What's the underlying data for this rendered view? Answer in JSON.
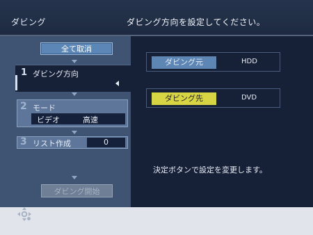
{
  "header": {
    "app_title": "ダビング",
    "instruction": "ダビング方向を設定してください。"
  },
  "left_panel": {
    "cancel_all_label": "全て取消",
    "steps": [
      {
        "number": "1",
        "label": "ダビング方向"
      },
      {
        "number": "2",
        "label": "モード",
        "values": [
          "ビデオ",
          "高速"
        ]
      },
      {
        "number": "3",
        "label": "リスト作成",
        "value": "0"
      }
    ],
    "start_button_label": "ダビング開始"
  },
  "right_panel": {
    "source": {
      "label": "ダビング元",
      "value": "HDD"
    },
    "destination": {
      "label": "ダビング先",
      "value": "DVD"
    },
    "hint": "決定ボタンで設定を変更します。"
  },
  "footer": {
    "nav_icon": "directional-pad-icon"
  },
  "colors": {
    "header_bg": "#1f2c44",
    "left_panel_bg": "#3f5473",
    "right_panel_bg": "#162037",
    "button_blue": "#5b86b6",
    "selected_yellow": "#d8d545"
  }
}
